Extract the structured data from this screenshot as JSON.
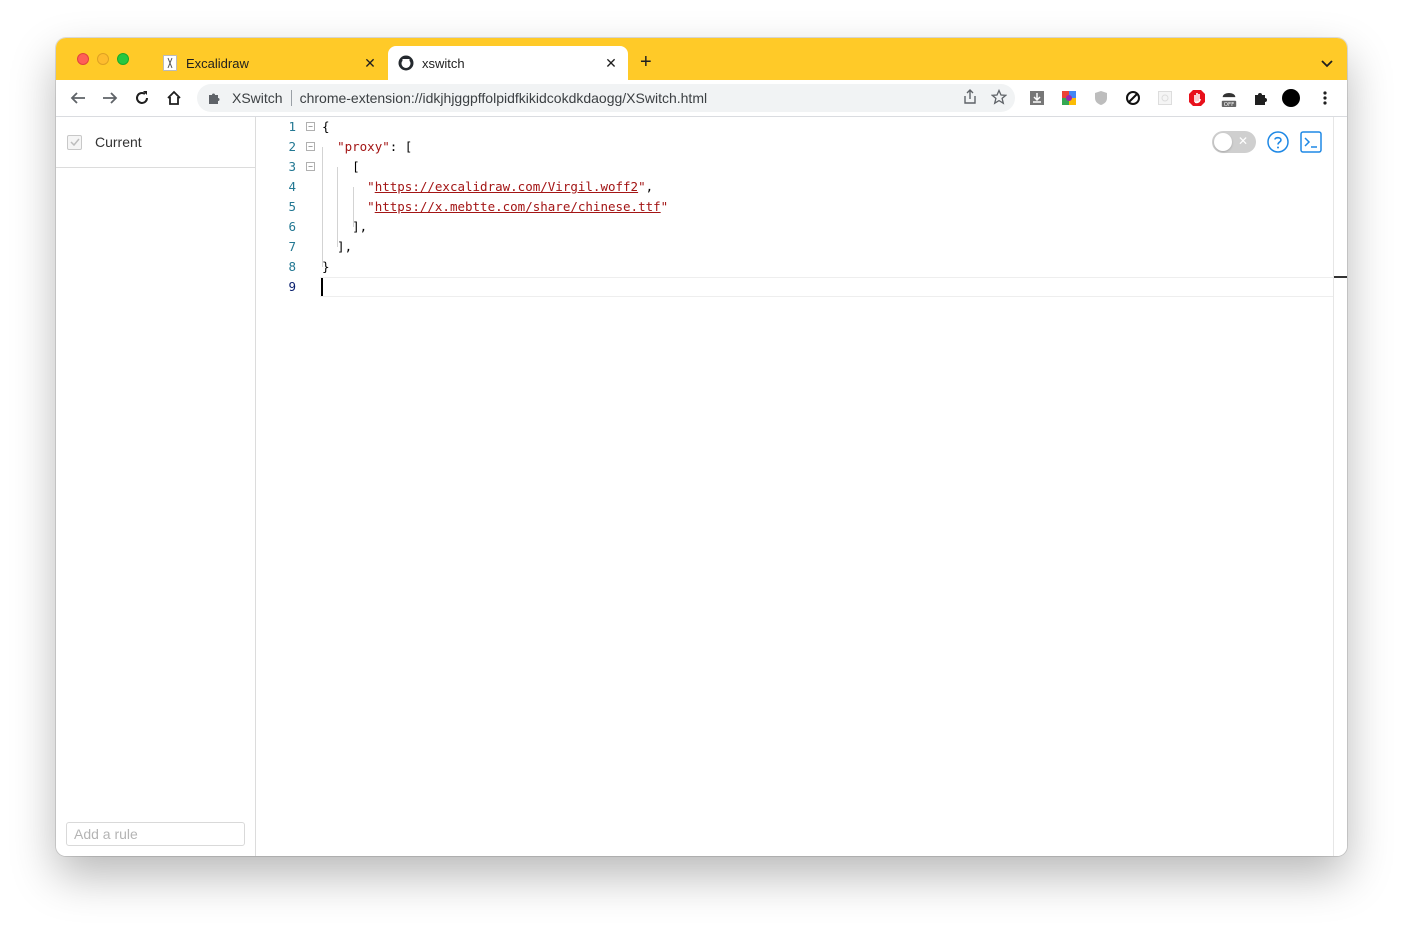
{
  "browser": {
    "tabs": [
      {
        "title": "Excalidraw",
        "active": false,
        "icon": "excalidraw-icon"
      },
      {
        "title": "xswitch",
        "active": true,
        "icon": "github-icon"
      }
    ],
    "new_tab_label": "+",
    "address": {
      "extension_name": "XSwitch",
      "url": "chrome-extension://idkjhjggpffolpidfkikidcokdkdaogg/XSwitch.html"
    },
    "accent_color": "#ffca28"
  },
  "sidebar": {
    "current_label": "Current",
    "current_checked": true,
    "add_rule_placeholder": "Add a rule"
  },
  "editor": {
    "line_numbers": [
      "1",
      "2",
      "3",
      "4",
      "5",
      "6",
      "7",
      "8",
      "9"
    ],
    "lines": [
      "{",
      "  \"proxy\": [",
      "    [",
      "      \"https://excalidraw.com/Virgil.woff2\",",
      "      \"https://x.mebtte.com/share/chinese.ttf\"",
      "    ],",
      "  ],",
      "}",
      ""
    ],
    "tokens": {
      "key": "\"proxy\"",
      "url1": "https://excalidraw.com/Virgil.woff2",
      "url2": "https://x.mebtte.com/share/chinese.ttf"
    }
  },
  "controls": {
    "toggle_state": "off",
    "toggle_off_label": "✕"
  }
}
